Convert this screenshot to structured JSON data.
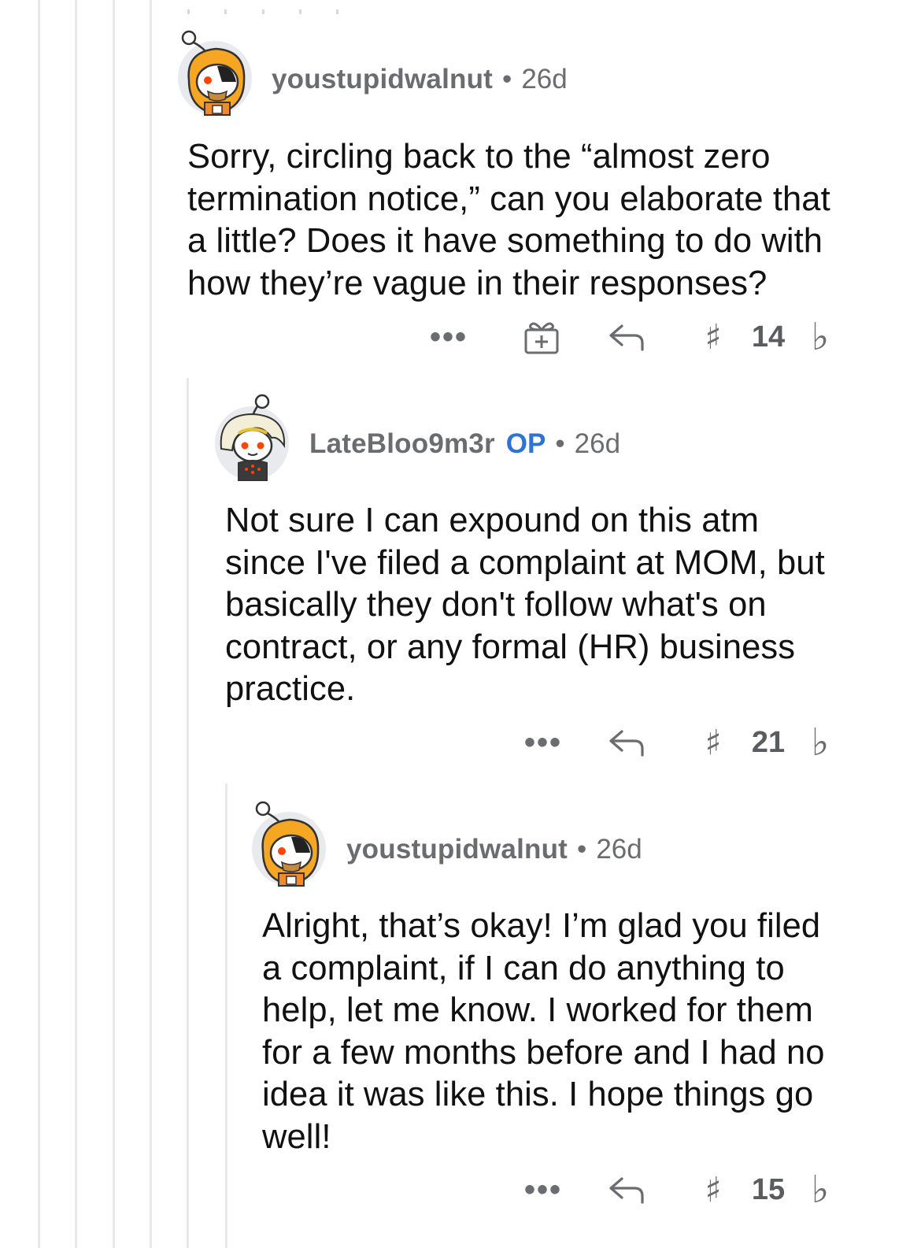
{
  "comments": [
    {
      "username": "youstupidwalnut",
      "op_badge": "",
      "separator": "•",
      "age": "26d",
      "lines": [
        "Sorry, circling back to the “almost zero",
        "termination notice,” can you elaborate that",
        "a little? Does it have something to do with",
        "how they’re vague in their responses?"
      ],
      "more": "•••",
      "vote_up_glyph": "♯",
      "votes": "14",
      "vote_down_glyph": "♭",
      "avatar_icon": "snoo-orange-hood-eyepatch-avatar"
    },
    {
      "username": "LateBloo9m3r",
      "op_badge": "OP",
      "separator": "•",
      "age": "26d",
      "lines": [
        "Not sure I can expound on this atm",
        "since I've filed a complaint at MOM, but",
        "basically they don't follow what's on",
        "contract, or any formal (HR) business",
        "practice."
      ],
      "more": "•••",
      "vote_up_glyph": "♯",
      "votes": "21",
      "vote_down_glyph": "♭",
      "avatar_icon": "snoo-blonde-hair-avatar"
    },
    {
      "username": "youstupidwalnut",
      "op_badge": "",
      "separator": "•",
      "age": "26d",
      "lines": [
        "Alright, that’s okay! I’m glad you filed",
        "a complaint, if I can do anything to",
        "help, let me know. I worked for them",
        "for a few months before and I had no",
        "idea it was like this. I hope things go",
        "well!"
      ],
      "more": "•••",
      "vote_up_glyph": "♯",
      "votes": "15",
      "vote_down_glyph": "♭",
      "avatar_icon": "snoo-orange-hood-eyepatch-avatar"
    }
  ],
  "colors": {
    "thread_line": "#e9e9ea",
    "meta_text": "#6b6c6f",
    "op_badge": "#2f72d6",
    "avatar_orange": "#f5a623",
    "snoo_red": "#ff4500"
  },
  "icons": {
    "more": "more-options-icon",
    "award": "gift-award-icon",
    "reply": "reply-arrow-icon",
    "upvote": "upvote-icon",
    "downvote": "downvote-icon"
  }
}
